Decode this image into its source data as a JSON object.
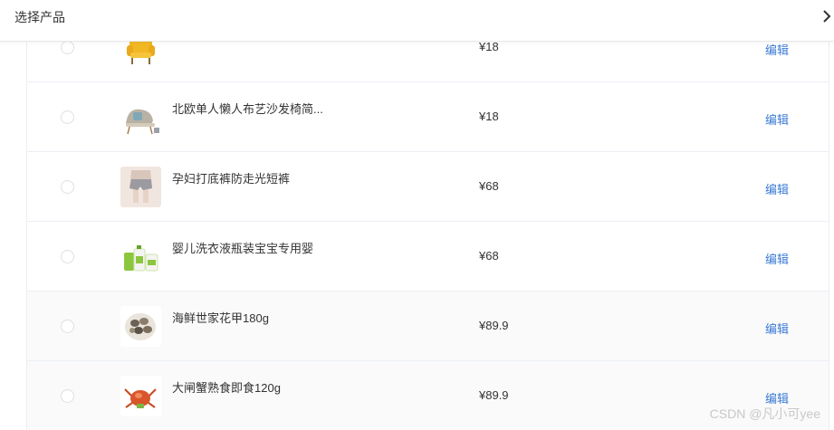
{
  "header": {
    "title": "选择产品",
    "close_icon": "chevron-right-icon"
  },
  "rows": [
    {
      "name": "",
      "price": "¥18",
      "edit": "编辑",
      "thumb_icon": "yellow-armchair"
    },
    {
      "name": "北欧单人懒人布艺沙发椅简...",
      "price": "¥18",
      "edit": "编辑",
      "thumb_icon": "lounge-chair"
    },
    {
      "name": "孕妇打底裤防走光短裤",
      "price": "¥68",
      "edit": "编辑",
      "thumb_icon": "shorts"
    },
    {
      "name": "婴儿洗衣液瓶装宝宝专用婴",
      "price": "¥68",
      "edit": "编辑",
      "thumb_icon": "detergent-bottles"
    },
    {
      "name": "海鲜世家花甲180g",
      "price": "¥89.9",
      "edit": "编辑",
      "thumb_icon": "clams-plate"
    },
    {
      "name": "大闸蟹熟食即食120g",
      "price": "¥89.9",
      "edit": "编辑",
      "thumb_icon": "crab"
    }
  ],
  "watermark": "CSDN @凡小可yee",
  "colors": {
    "link": "#3a7bd5",
    "border": "#ebeef5",
    "alt_row": "#fafafa"
  }
}
